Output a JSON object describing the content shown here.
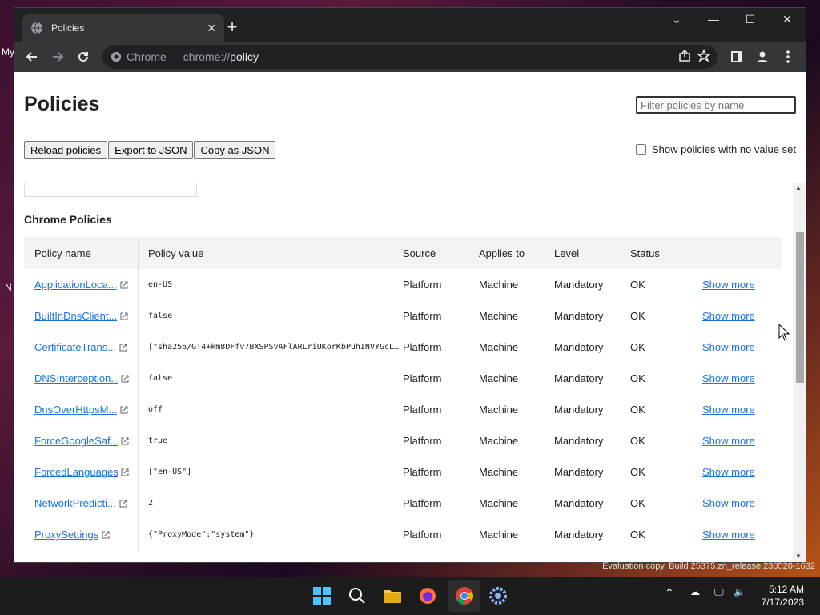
{
  "desktop": {
    "left_text_1": "My",
    "left_text_2": "N"
  },
  "tab": {
    "title": "Policies"
  },
  "window_controls": {
    "minimize": "—",
    "maximize": "☐",
    "close": "✕",
    "dropdown": "⌄"
  },
  "address_bar": {
    "site_label": "Chrome",
    "url_prefix": "chrome://",
    "url_main": "policy"
  },
  "page": {
    "title": "Policies",
    "filter_placeholder": "Filter policies by name",
    "buttons": {
      "reload": "Reload policies",
      "export": "Export to JSON",
      "copy": "Copy as JSON"
    },
    "show_no_value_label": "Show policies with no value set",
    "section_title": "Chrome Policies",
    "columns": {
      "name": "Policy name",
      "value": "Policy value",
      "source": "Source",
      "applies": "Applies to",
      "level": "Level",
      "status": "Status"
    },
    "rows": [
      {
        "name": "ApplicationLoca...",
        "value": "en-US",
        "source": "Platform",
        "applies": "Machine",
        "level": "Mandatory",
        "status": "OK",
        "more": "Show more"
      },
      {
        "name": "BuiltInDnsClient...",
        "value": "false",
        "source": "Platform",
        "applies": "Machine",
        "level": "Mandatory",
        "status": "OK",
        "more": "Show more"
      },
      {
        "name": "CertificateTrans...",
        "value": "[\"sha256/GT4+km8DFfv7BXSPSvAFlARLriUKorKbPuhINVYGcL…",
        "source": "Platform",
        "applies": "Machine",
        "level": "Mandatory",
        "status": "OK",
        "more": "Show more"
      },
      {
        "name": "DNSInterception...",
        "value": "false",
        "source": "Platform",
        "applies": "Machine",
        "level": "Mandatory",
        "status": "OK",
        "more": "Show more"
      },
      {
        "name": "DnsOverHttpsM...",
        "value": "off",
        "source": "Platform",
        "applies": "Machine",
        "level": "Mandatory",
        "status": "OK",
        "more": "Show more"
      },
      {
        "name": "ForceGoogleSaf...",
        "value": "true",
        "source": "Platform",
        "applies": "Machine",
        "level": "Mandatory",
        "status": "OK",
        "more": "Show more"
      },
      {
        "name": "ForcedLanguages",
        "value": "[\"en-US\"]",
        "source": "Platform",
        "applies": "Machine",
        "level": "Mandatory",
        "status": "OK",
        "more": "Show more"
      },
      {
        "name": "NetworkPredicti...",
        "value": "2",
        "source": "Platform",
        "applies": "Machine",
        "level": "Mandatory",
        "status": "OK",
        "more": "Show more"
      },
      {
        "name": "ProxySettings",
        "value": "{\"ProxyMode\":\"system\"}",
        "source": "Platform",
        "applies": "Machine",
        "level": "Mandatory",
        "status": "OK",
        "more": "Show more"
      }
    ]
  },
  "taskbar": {
    "time": "5:12 AM",
    "date": "7/17/2023",
    "eval_note": "Evaluation copy. Build 25375.zn_release.230520-1632"
  },
  "colors": {
    "link": "#1a73e8",
    "tabstrip": "#202124",
    "toolbar": "#35363a"
  }
}
